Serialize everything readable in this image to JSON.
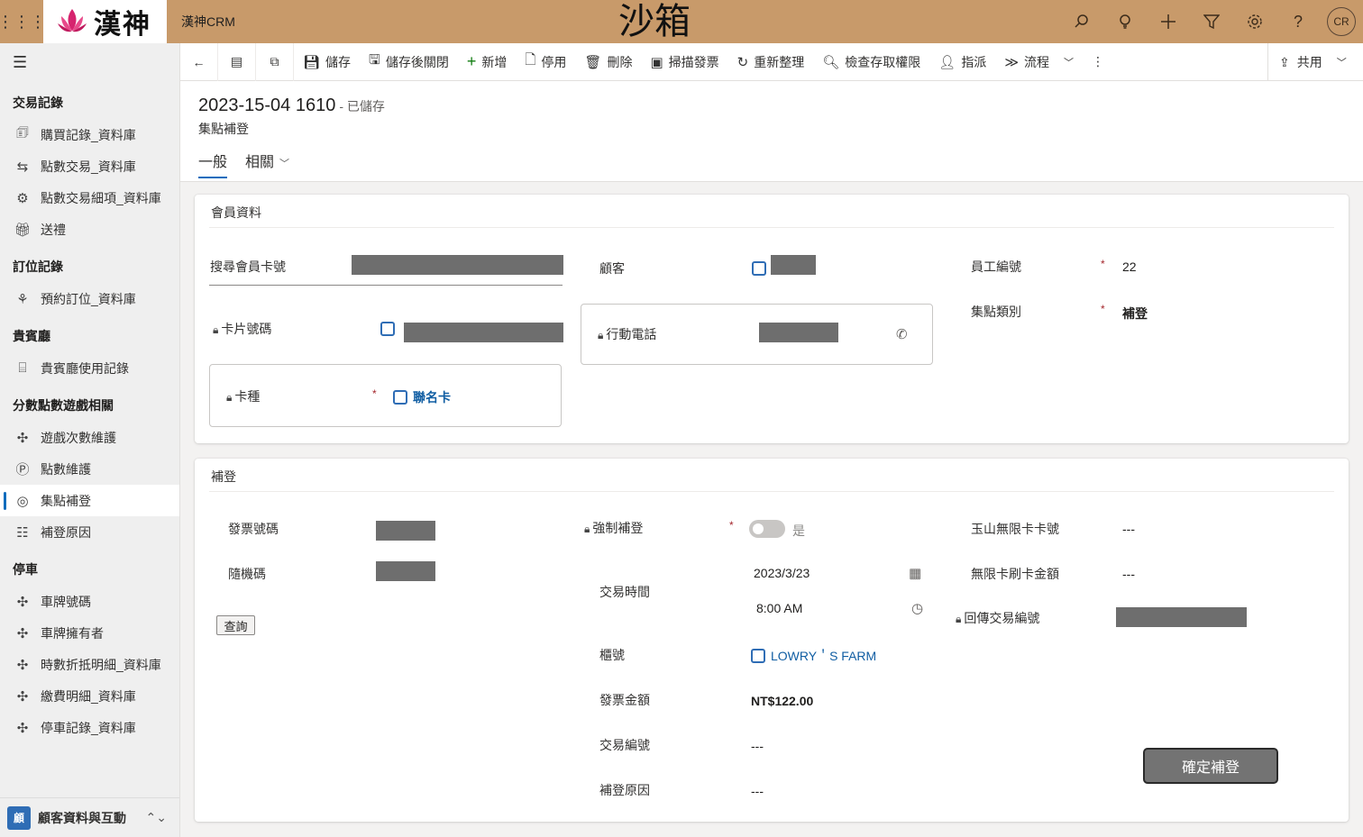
{
  "topbar": {
    "logo_text": "漢神",
    "app_name": "漢神CRM",
    "environment_label": "沙箱",
    "user_initials": "CR",
    "icons": [
      "search-icon",
      "lightbulb-icon",
      "plus-icon",
      "filter-icon",
      "gear-icon",
      "help-icon"
    ]
  },
  "sidebar": {
    "groups": [
      {
        "title": "交易記錄",
        "items": [
          {
            "label": "購買記錄_資料庫",
            "icon": "receipt-icon"
          },
          {
            "label": "點數交易_資料庫",
            "icon": "exchange-icon"
          },
          {
            "label": "點數交易細項_資料庫",
            "icon": "detail-icon"
          },
          {
            "label": "送禮",
            "icon": "gift-icon"
          }
        ]
      },
      {
        "title": "訂位記錄",
        "items": [
          {
            "label": "預約訂位_資料庫",
            "icon": "reservation-icon"
          }
        ]
      },
      {
        "title": "貴賓廳",
        "items": [
          {
            "label": "貴賓廳使用記錄",
            "icon": "lounge-icon"
          }
        ]
      },
      {
        "title": "分數點數遊戲相關",
        "items": [
          {
            "label": "遊戲次數維護",
            "icon": "puzzle-icon"
          },
          {
            "label": "點數維護",
            "icon": "points-icon"
          },
          {
            "label": "集點補登",
            "icon": "stamp-icon",
            "active": true
          },
          {
            "label": "補登原因",
            "icon": "list-icon"
          }
        ]
      },
      {
        "title": "停車",
        "items": [
          {
            "label": "車牌號碼",
            "icon": "puzzle-icon"
          },
          {
            "label": "車牌擁有者",
            "icon": "puzzle-icon"
          },
          {
            "label": "時數折抵明細_資料庫",
            "icon": "puzzle-icon"
          },
          {
            "label": "繳費明細_資料庫",
            "icon": "puzzle-icon"
          },
          {
            "label": "停車記錄_資料庫",
            "icon": "puzzle-icon"
          }
        ]
      }
    ],
    "area_switch": {
      "badge": "顧",
      "label": "顧客資料與互動"
    }
  },
  "commands": {
    "save": "儲存",
    "save_close": "儲存後關閉",
    "new": "新增",
    "deactivate": "停用",
    "delete": "刪除",
    "scan_invoice": "掃描發票",
    "refresh": "重新整理",
    "check_access": "檢查存取權限",
    "assign": "指派",
    "flow": "流程",
    "share": "共用"
  },
  "header": {
    "title": "2023-15-04 1610",
    "status": "- 已儲存",
    "entity": "集點補登",
    "tabs": [
      {
        "label": "一般"
      },
      {
        "label": "相關"
      }
    ]
  },
  "member_section": {
    "title": "會員資料",
    "search_card_label": "搜尋會員卡號",
    "card_number_label": "卡片號碼",
    "card_type_label": "卡種",
    "card_type_value": "聯名卡",
    "customer_label": "顧客",
    "mobile_label": "行動電話",
    "employee_id_label": "員工編號",
    "employee_id_value": "22",
    "point_category_label": "集點類別",
    "point_category_value": "補登"
  },
  "supplement_section": {
    "title": "補登",
    "invoice_no_label": "發票號碼",
    "random_code_label": "隨機碼",
    "query_button": "查詢",
    "force_label": "強制補登",
    "force_value": "是",
    "txn_time_label": "交易時間",
    "txn_date": "2023/3/23",
    "txn_time": "8:00 AM",
    "counter_label": "櫃號",
    "counter_value": "LOWRY＇S FARM",
    "invoice_amount_label": "發票金額",
    "invoice_amount_value": "NT$122.00",
    "txn_no_label": "交易編號",
    "txn_no_value": "---",
    "reason_label": "補登原因",
    "reason_value": "---",
    "esun_card_label": "玉山無限卡卡號",
    "esun_card_value": "---",
    "unlimited_amount_label": "無限卡刷卡金額",
    "unlimited_amount_value": "---",
    "return_txn_label": "回傳交易編號",
    "confirm_button": "確定補登"
  }
}
